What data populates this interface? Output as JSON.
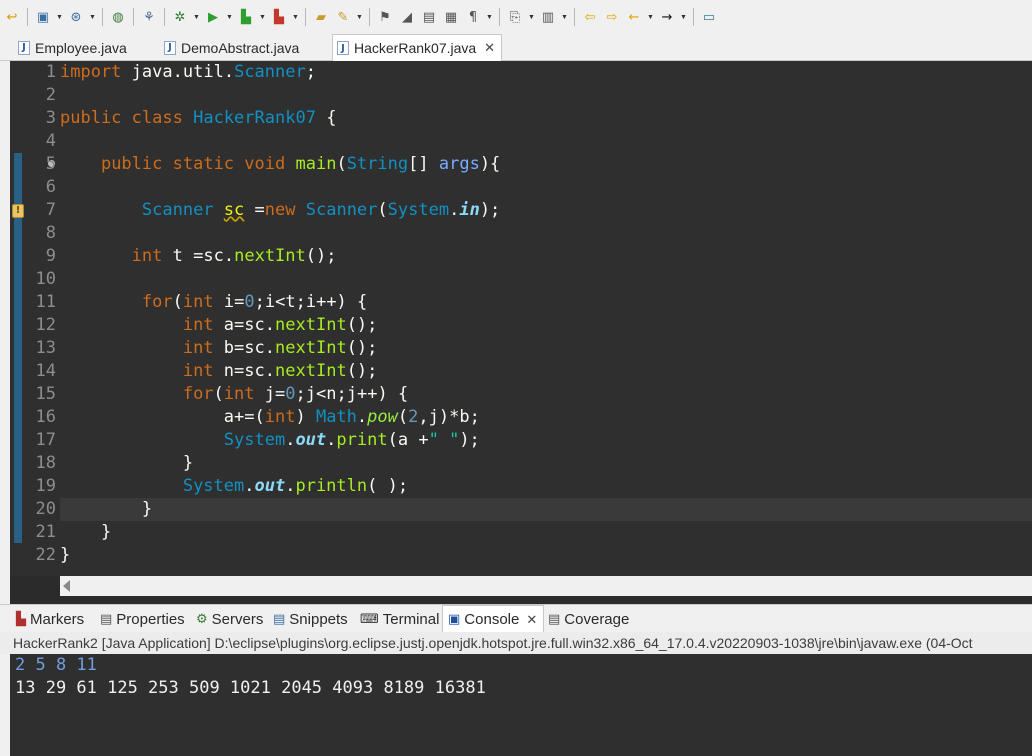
{
  "toolbar": {
    "icons": [
      "wrap-icon",
      "new-icon",
      "run-history-icon",
      "globe-icon",
      "debug-icon",
      "bug-icon",
      "run-icon",
      "coverage-icon",
      "external-tools-icon",
      "open-folder-icon",
      "pen-icon",
      "annotation-icon",
      "pencil-icon",
      "next-annotation-icon",
      "blocks-icon",
      "paragraph-icon",
      "save-icon",
      "pin-icon",
      "back-icon",
      "forward-icon",
      "arrow-left-icon",
      "arrow-right-icon",
      "new-window-icon"
    ]
  },
  "editor_tabs": [
    {
      "label": "Employee.java"
    },
    {
      "label": "DemoAbstract.java"
    },
    {
      "label": "HackerRank07.java",
      "active": true
    }
  ],
  "code": {
    "line_numbers": [
      "1",
      "2",
      "3",
      "4",
      "5",
      "6",
      "7",
      "8",
      "9",
      "10",
      "11",
      "12",
      "13",
      "14",
      "15",
      "16",
      "17",
      "18",
      "19",
      "20",
      "21",
      "22"
    ],
    "lines": [
      "import java.util.Scanner;",
      "",
      "public class HackerRank07 {",
      "",
      "    public static void main(String[] args){",
      "",
      "        Scanner sc =new Scanner(System.in);",
      "",
      "       int t =sc.nextInt();",
      "",
      "        for(int i=0;i<t;i++) {",
      "            int a=sc.nextInt();",
      "            int b=sc.nextInt();",
      "            int n=sc.nextInt();",
      "            for(int j=0;j<n;j++) {",
      "                a+=(int) Math.pow(2,j)*b;",
      "                System.out.print(a +\" \");",
      "            }",
      "            System.out.println( );",
      "        }",
      "    }",
      "}"
    ]
  },
  "views": {
    "tabs": [
      {
        "label": "Markers",
        "icon": "markers-icon"
      },
      {
        "label": "Properties",
        "icon": "properties-icon"
      },
      {
        "label": "Servers",
        "icon": "servers-icon"
      },
      {
        "label": "Snippets",
        "icon": "snippets-icon"
      },
      {
        "label": "Terminal",
        "icon": "terminal-icon"
      },
      {
        "label": "Console",
        "icon": "console-icon",
        "active": true
      },
      {
        "label": "Coverage",
        "icon": "coverage-icon"
      }
    ]
  },
  "console": {
    "description": "HackerRank2 [Java Application] D:\\eclipse\\plugins\\org.eclipse.justj.openjdk.hotspot.jre.full.win32.x86_64_17.0.4.v20220903-1038\\jre\\bin\\javaw.exe  (04-Oct",
    "input_line": "2 5 8 11",
    "output_line": "13 29 61 125 253 509 1021 2045 4093 8189 16381"
  },
  "colors": {
    "keyword": "#cc6c1d",
    "type": "#1290c3",
    "method": "#a7ec21",
    "string": "#17c6a3",
    "console_input": "#6f9dde"
  }
}
